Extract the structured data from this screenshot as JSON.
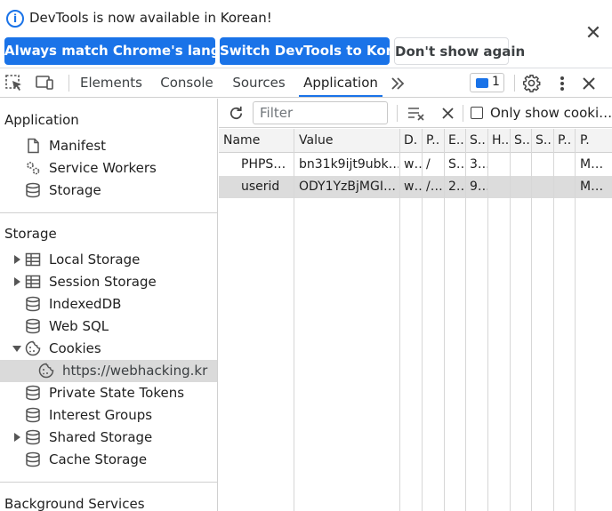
{
  "infobar": {
    "message": "DevTools is now available in Korean!",
    "btn_match": "Always match Chrome's language",
    "btn_switch": "Switch DevTools to Korean",
    "btn_dont_show": "Don't show again"
  },
  "tabs": {
    "elements": "Elements",
    "console": "Console",
    "sources": "Sources",
    "application": "Application",
    "message_count": "1"
  },
  "sidebar": {
    "application_head": "Application",
    "app_items": [
      "Manifest",
      "Service Workers",
      "Storage"
    ],
    "storage_head": "Storage",
    "storage_items": [
      "Local Storage",
      "Session Storage",
      "IndexedDB",
      "Web SQL",
      "Cookies",
      "https://webhacking.kr",
      "Private State Tokens",
      "Interest Groups",
      "Shared Storage",
      "Cache Storage"
    ],
    "background_head": "Background Services"
  },
  "cookies": {
    "filter_placeholder": "Filter",
    "only_show_label": "Only show cooki…",
    "headers": [
      "Name",
      "Value",
      "D.",
      "P..",
      "E..",
      "S..",
      "H..",
      "S..",
      "S..",
      "P..",
      "P."
    ],
    "rows": [
      [
        "PHPS…",
        "bn31k9ijt9ubk…",
        "w…",
        "/",
        "S…",
        "3…",
        "",
        "",
        "",
        "",
        "M…"
      ],
      [
        "userid",
        "ODY1YzBjMGI…",
        "w…",
        "/…",
        "2…",
        "9…",
        "",
        "",
        "",
        "",
        "M…"
      ]
    ]
  },
  "colors": {
    "accent": "#1a73e8",
    "selected_row": "#dcdcdc"
  }
}
